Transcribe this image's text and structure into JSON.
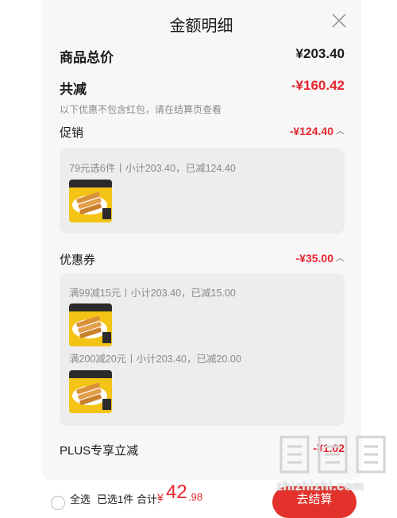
{
  "sheet": {
    "title": "金额明细"
  },
  "summary": {
    "subtotal_label": "商品总价",
    "subtotal_value": "¥203.40",
    "discount_label": "共减",
    "discount_value": "-¥160.42",
    "discount_hint": "以下优惠不包含红包，请在结算页查看"
  },
  "promotion": {
    "label": "促销",
    "value": "-¥124.40",
    "items": [
      {
        "text": "79元选6件丨小计203.40，已减124.40"
      }
    ]
  },
  "coupon": {
    "label": "优惠券",
    "value": "-¥35.00",
    "items": [
      {
        "text": "满99减15元丨小计203.40，已减15.00"
      },
      {
        "text": "满200减20元丨小计203.40，已减20.00"
      }
    ]
  },
  "plus": {
    "label": "PLUS专享立减",
    "value": "-¥1.02"
  },
  "footer": {
    "select_all": "全选",
    "selected": "已选1件",
    "total_label": "合计:",
    "total_symbol": "¥",
    "total_int": "42",
    "total_dec": ".98",
    "checkout": "去结算"
  },
  "watermark": {
    "text": "zhizhizhi.com",
    "logo": "值值值"
  },
  "colors": {
    "accent_red": "#e5252f",
    "checkout_red": "#e2322b",
    "thumb_yellow": "#f3c316"
  }
}
